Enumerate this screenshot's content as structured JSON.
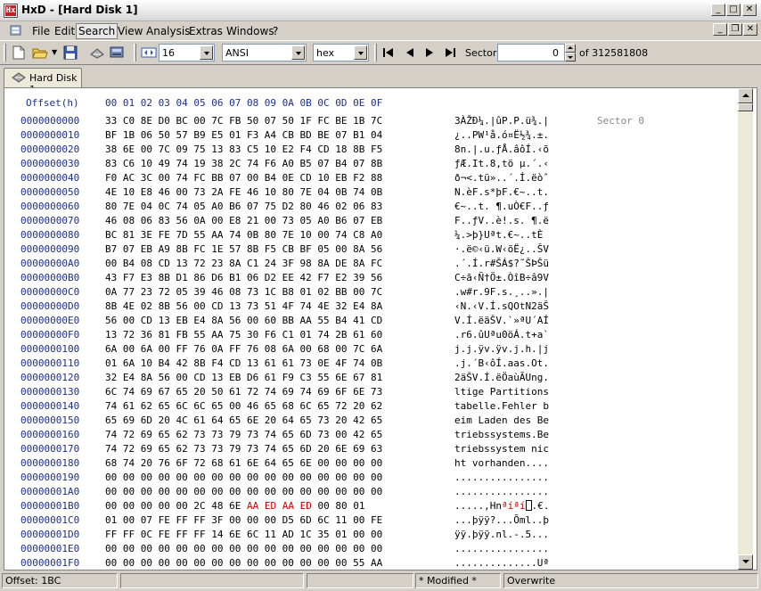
{
  "window": {
    "title": "HxD - [Hard Disk 1]",
    "app_icon_text": "Hx"
  },
  "menu": [
    "File",
    "Edit",
    "Search",
    "View",
    "Analysis",
    "Extras",
    "Windows",
    "?"
  ],
  "toolbar": {
    "bytes_per_row": "16",
    "charset": "ANSI",
    "offset_base": "hex",
    "sector_label": "Sector",
    "sector_value": "0",
    "sector_total": "of 312581808"
  },
  "tab": {
    "label": "Hard Disk 1"
  },
  "editor": {
    "header_offset": "Offset(h)",
    "header_columns": "00 01 02 03 04 05 06 07 08 09 0A 0B 0C 0D 0E 0F",
    "sector_marker": "Sector 0",
    "rows": [
      {
        "offset": "0000000000",
        "hex": "33 C0 8E D0 BC 00 7C FB 50 07 50 1F FC BE 1B 7C",
        "ascii": "3ÀŽÐ¼.|ûP.P.ü¾.|"
      },
      {
        "offset": "0000000010",
        "hex": "BF 1B 06 50 57 B9 E5 01 F3 A4 CB BD BE 07 B1 04",
        "ascii": "¿..PW¹å.ó¤Ë½¾.±."
      },
      {
        "offset": "0000000020",
        "hex": "38 6E 00 7C 09 75 13 83 C5 10 E2 F4 CD 18 8B F5",
        "ascii": "8n.|.u.ƒÅ.âôÍ.‹õ"
      },
      {
        "offset": "0000000030",
        "hex": "83 C6 10 49 74 19 38 2C 74 F6 A0 B5 07 B4 07 8B",
        "ascii": "ƒÆ.It.8,tö µ.´.‹"
      },
      {
        "offset": "0000000040",
        "hex": "F0 AC 3C 00 74 FC BB 07 00 B4 0E CD 10 EB F2 88",
        "ascii": "ð¬<.tü»..´.Í.ëòˆ"
      },
      {
        "offset": "0000000050",
        "hex": "4E 10 E8 46 00 73 2A FE 46 10 80 7E 04 0B 74 0B",
        "ascii": "N.èF.s*þF.€~..t."
      },
      {
        "offset": "0000000060",
        "hex": "80 7E 04 0C 74 05 A0 B6 07 75 D2 80 46 02 06 83",
        "ascii": "€~..t. ¶.uÒ€F..ƒ"
      },
      {
        "offset": "0000000070",
        "hex": "46 08 06 83 56 0A 00 E8 21 00 73 05 A0 B6 07 EB",
        "ascii": "F..ƒV..è!.s. ¶.ë"
      },
      {
        "offset": "0000000080",
        "hex": "BC 81 3E FE 7D 55 AA 74 0B 80 7E 10 00 74 C8 A0",
        "ascii": "¼.>þ}Uªt.€~..tÈ "
      },
      {
        "offset": "0000000090",
        "hex": "B7 07 EB A9 8B FC 1E 57 8B F5 CB BF 05 00 8A 56",
        "ascii": "·.ë©‹ü.W‹õË¿..ŠV"
      },
      {
        "offset": "00000000A0",
        "hex": "00 B4 08 CD 13 72 23 8A C1 24 3F 98 8A DE 8A FC",
        "ascii": ".´.Í.r#ŠÁ$?˜ŠÞŠü"
      },
      {
        "offset": "00000000B0",
        "hex": "43 F7 E3 8B D1 86 D6 B1 06 D2 EE 42 F7 E2 39 56",
        "ascii": "C÷ã‹Ñ†Ö±.ÒîB÷â9V"
      },
      {
        "offset": "00000000C0",
        "hex": "0A 77 23 72 05 39 46 08 73 1C B8 01 02 BB 00 7C",
        "ascii": ".w#r.9F.s.¸..».|"
      },
      {
        "offset": "00000000D0",
        "hex": "8B 4E 02 8B 56 00 CD 13 73 51 4F 74 4E 32 E4 8A",
        "ascii": "‹N.‹V.Í.sQOtN2äŠ"
      },
      {
        "offset": "00000000E0",
        "hex": "56 00 CD 13 EB E4 8A 56 00 60 BB AA 55 B4 41 CD",
        "ascii": "V.Í.ëäŠV.`»ªU´AÍ"
      },
      {
        "offset": "00000000F0",
        "hex": "13 72 36 81 FB 55 AA 75 30 F6 C1 01 74 2B 61 60",
        "ascii": ".r6.ûUªu0öÁ.t+a`"
      },
      {
        "offset": "0000000100",
        "hex": "6A 00 6A 00 FF 76 0A FF 76 08 6A 00 68 00 7C 6A",
        "ascii": "j.j.ÿv.ÿv.j.h.|j"
      },
      {
        "offset": "0000000110",
        "hex": "01 6A 10 B4 42 8B F4 CD 13 61 61 73 0E 4F 74 0B",
        "ascii": ".j.´B‹ôÍ.aas.Ot."
      },
      {
        "offset": "0000000120",
        "hex": "32 E4 8A 56 00 CD 13 EB D6 61 F9 C3 55 6E 67 81",
        "ascii": "2äŠV.Í.ëÖaùÃUng."
      },
      {
        "offset": "0000000130",
        "hex": "6C 74 69 67 65 20 50 61 72 74 69 74 69 6F 6E 73",
        "ascii": "ltige Partitions"
      },
      {
        "offset": "0000000140",
        "hex": "74 61 62 65 6C 6C 65 00 46 65 68 6C 65 72 20 62",
        "ascii": "tabelle.Fehler b"
      },
      {
        "offset": "0000000150",
        "hex": "65 69 6D 20 4C 61 64 65 6E 20 64 65 73 20 42 65",
        "ascii": "eim Laden des Be"
      },
      {
        "offset": "0000000160",
        "hex": "74 72 69 65 62 73 73 79 73 74 65 6D 73 00 42 65",
        "ascii": "triebssystems.Be"
      },
      {
        "offset": "0000000170",
        "hex": "74 72 69 65 62 73 73 79 73 74 65 6D 20 6E 69 63",
        "ascii": "triebssystem nic"
      },
      {
        "offset": "0000000180",
        "hex": "68 74 20 76 6F 72 68 61 6E 64 65 6E 00 00 00 00",
        "ascii": "ht vorhanden...."
      },
      {
        "offset": "0000000190",
        "hex": "00 00 00 00 00 00 00 00 00 00 00 00 00 00 00 00",
        "ascii": "................"
      },
      {
        "offset": "00000001A0",
        "hex": "00 00 00 00 00 00 00 00 00 00 00 00 00 00 00 00",
        "ascii": "................"
      },
      {
        "offset": "00000001B0",
        "hex": "00 00 00 00 00 2C 48 6E AA ED AA ED 00 80 01",
        "ascii": ".....,Hnªíªí.€."
      },
      {
        "offset": "00000001C0",
        "hex": "01 00 07 FE FF FF 3F 00 00 00 D5 6D 6C 11 00 FE",
        "ascii": "...þÿÿ?...Õml..þ"
      },
      {
        "offset": "00000001D0",
        "hex": "FF FF 0C FE FF FF 14 6E 6C 11 AD 1C 35 01 00 00",
        "ascii": "ÿÿ.þÿÿ.nl.-.5..."
      },
      {
        "offset": "00000001E0",
        "hex": "00 00 00 00 00 00 00 00 00 00 00 00 00 00 00 00",
        "ascii": "................"
      },
      {
        "offset": "00000001F0",
        "hex": "00 00 00 00 00 00 00 00 00 00 00 00 00 00 55 AA",
        "ascii": "..............Uª"
      }
    ]
  },
  "status": {
    "offset": "Offset: 1BC",
    "modified": "* Modified *",
    "mode": "Overwrite"
  },
  "colors": {
    "offset_blue": "#1c2e8c",
    "modified_red": "#d00000",
    "sector_gray": "#8a8a8a"
  }
}
